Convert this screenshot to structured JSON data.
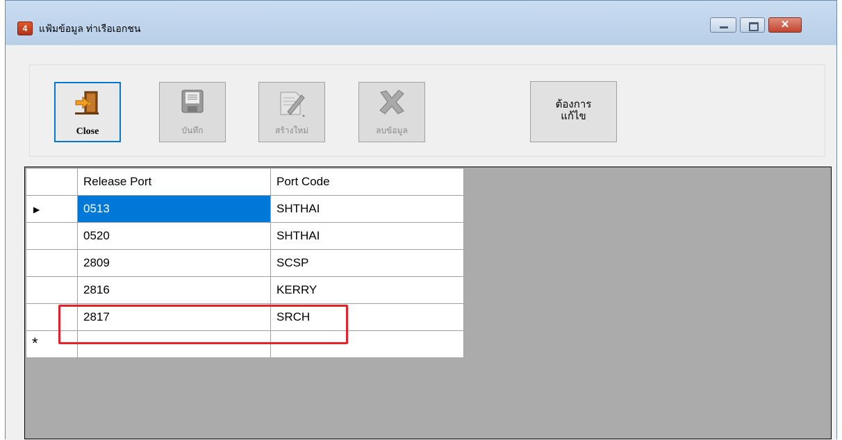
{
  "window": {
    "title": "แฟ้มข้อมูล ท่าเรือเอกชน",
    "app_icon_glyph": "4",
    "controls": {
      "minimize_icon": "minimize-icon",
      "maximize_icon": "maximize-icon",
      "close_glyph": "✕"
    }
  },
  "toolbar": {
    "close_label": "Close",
    "save_label": "บันทึก",
    "new_label": "สร้างใหม่",
    "delete_label": "ลบข้อมูล",
    "edit_label_line1": "ต้องการ",
    "edit_label_line2": "แก้ไข"
  },
  "grid": {
    "columns": [
      "Release Port",
      "Port Code"
    ],
    "rows": [
      {
        "release_port": "0513",
        "port_code": "SHTHAI",
        "current": true
      },
      {
        "release_port": "0520",
        "port_code": "SHTHAI"
      },
      {
        "release_port": "2809",
        "port_code": "SCSP"
      },
      {
        "release_port": "2816",
        "port_code": "KERRY"
      },
      {
        "release_port": "2817",
        "port_code": "SRCH"
      }
    ],
    "current_row_marker": "▶",
    "new_row_marker": "*"
  },
  "colors": {
    "selection": "#0078d7",
    "annotation": "#e8202a",
    "grid_background": "#ababab"
  }
}
